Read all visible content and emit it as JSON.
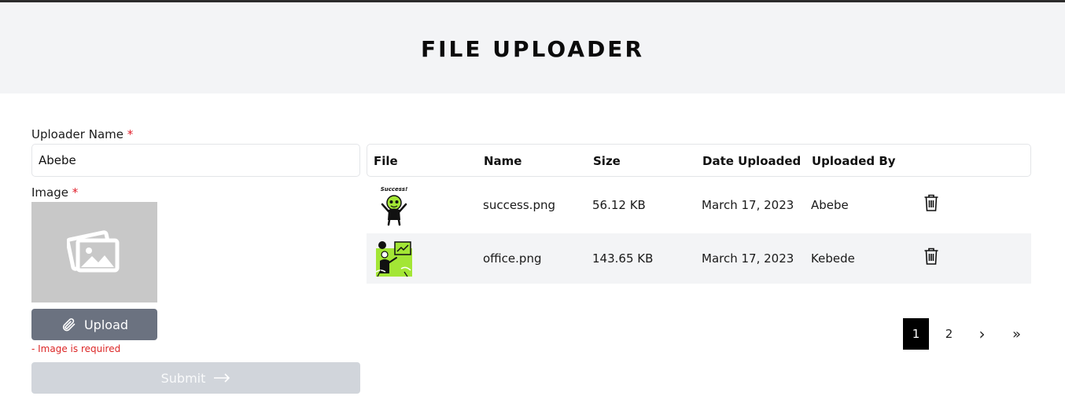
{
  "header": {
    "title": "FILE UPLOADER"
  },
  "form": {
    "name_label": "Uploader Name",
    "required_mark": "*",
    "name_value": "Abebe",
    "image_label": "Image",
    "upload_label": "Upload",
    "error_text": "- Image is required",
    "submit_label": "Submit"
  },
  "table": {
    "headers": [
      "File",
      "Name",
      "Size",
      "Date Uploaded",
      "Uploaded By"
    ],
    "rows": [
      {
        "name": "success.png",
        "size": "56.12 KB",
        "date": "March 17, 2023",
        "uploaded_by": "Abebe",
        "thumb_text": "Success!"
      },
      {
        "name": "office.png",
        "size": "143.65 KB",
        "date": "March 17, 2023",
        "uploaded_by": "Kebede"
      }
    ]
  },
  "pagination": {
    "pages": [
      "1",
      "2"
    ],
    "active_page": "1",
    "next": "›",
    "last": "»"
  },
  "colors": {
    "accent_red": "#e11d2a",
    "upload_button": "#6b7280",
    "submit_disabled": "#d1d5db",
    "header_bg": "#f3f4f6",
    "row_alt_bg": "#f3f4f6",
    "thumb_green": "#a3e635"
  }
}
